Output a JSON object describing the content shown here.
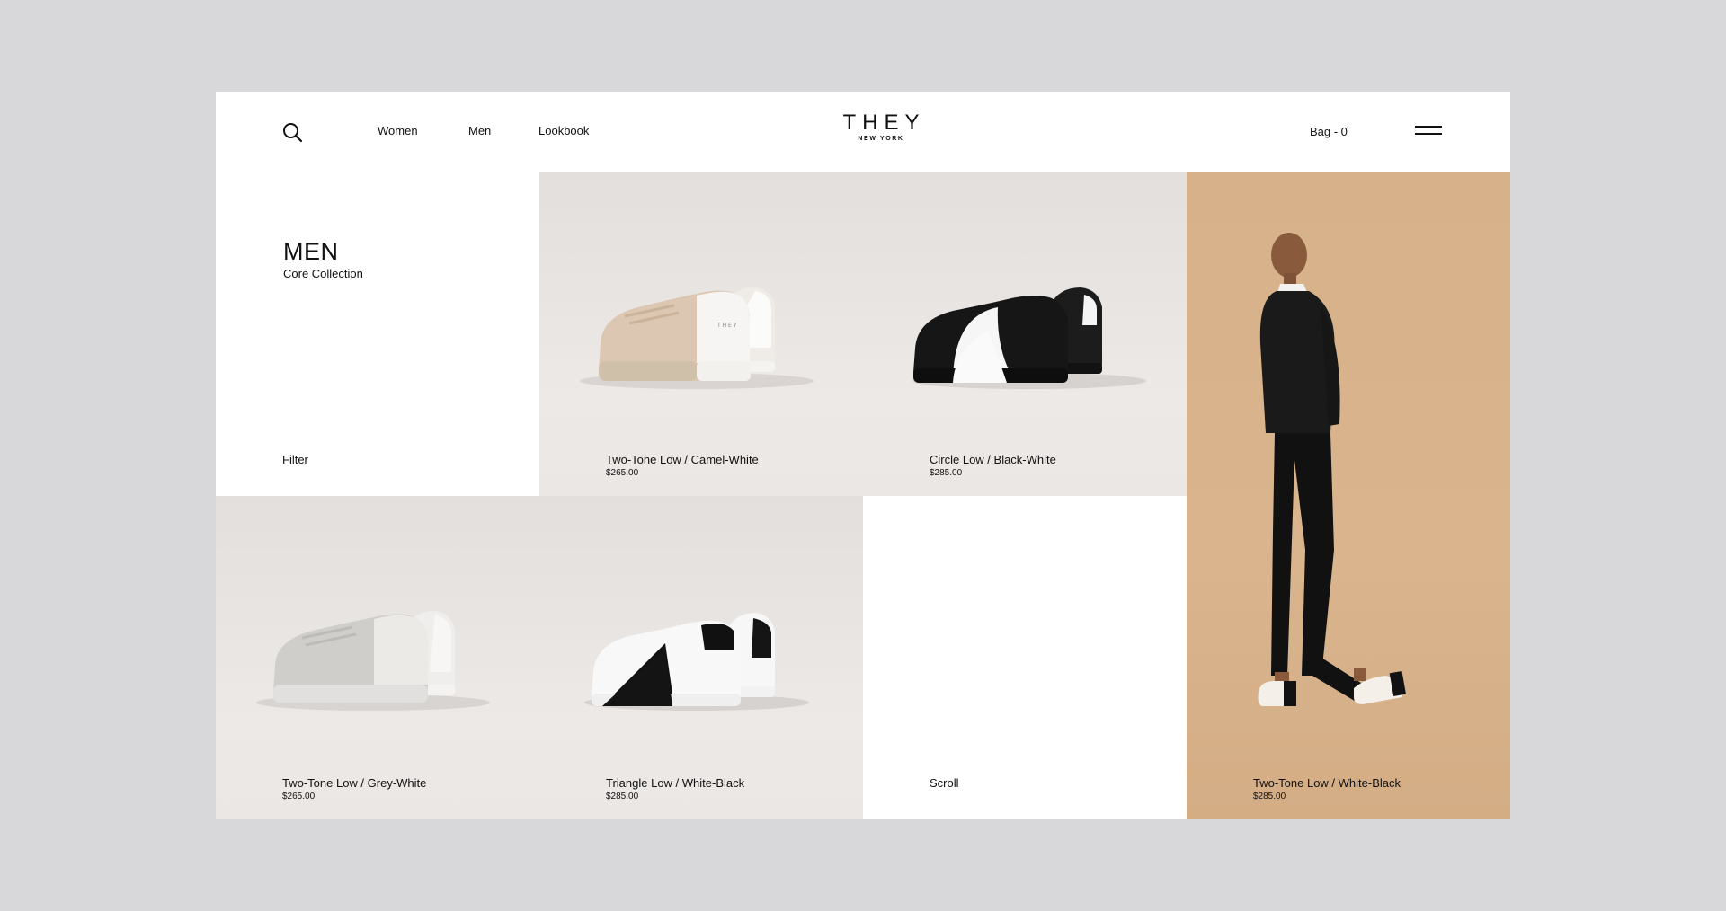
{
  "header": {
    "search_icon": "search-icon",
    "nav": [
      "Women",
      "Men",
      "Lookbook"
    ],
    "logo": {
      "main": "THEY",
      "sub": "NEW YORK"
    },
    "bag": "Bag - 0",
    "menu_icon": "hamburger-menu-icon"
  },
  "category": {
    "title": "MEN",
    "subtitle": "Core Collection",
    "filter": "Filter"
  },
  "scroll_label": "Scroll",
  "products": [
    {
      "name": "Two-Tone Low / Camel-White",
      "price": "$265.00"
    },
    {
      "name": "Circle Low / Black-White",
      "price": "$285.00"
    },
    {
      "name": "Two-Tone Low / Grey-White",
      "price": "$265.00"
    },
    {
      "name": "Triangle Low / White-Black",
      "price": "$285.00"
    },
    {
      "name": "Two-Tone Low / White-Black",
      "price": "$285.00"
    }
  ],
  "colors": {
    "page_bg": "#d8d8da",
    "tile_grey": "#ebe7e5",
    "tile_tan": "#d7b189",
    "text": "#111111"
  }
}
